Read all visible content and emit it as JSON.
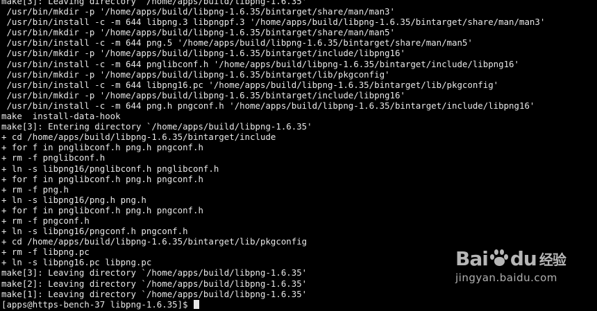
{
  "terminal": {
    "lines": [
      "make[3]: Leaving directory `/home/apps/build/libpng-1.6.35'",
      " /usr/bin/mkdir -p '/home/apps/build/libpng-1.6.35/bintarget/share/man/man3'",
      " /usr/bin/install -c -m 644 libpng.3 libpngpf.3 '/home/apps/build/libpng-1.6.35/bintarget/share/man/man3'",
      " /usr/bin/mkdir -p '/home/apps/build/libpng-1.6.35/bintarget/share/man/man5'",
      " /usr/bin/install -c -m 644 png.5 '/home/apps/build/libpng-1.6.35/bintarget/share/man/man5'",
      " /usr/bin/mkdir -p '/home/apps/build/libpng-1.6.35/bintarget/include/libpng16'",
      " /usr/bin/install -c -m 644 pnglibconf.h '/home/apps/build/libpng-1.6.35/bintarget/include/libpng16'",
      " /usr/bin/mkdir -p '/home/apps/build/libpng-1.6.35/bintarget/lib/pkgconfig'",
      " /usr/bin/install -c -m 644 libpng16.pc '/home/apps/build/libpng-1.6.35/bintarget/lib/pkgconfig'",
      " /usr/bin/mkdir -p '/home/apps/build/libpng-1.6.35/bintarget/include/libpng16'",
      " /usr/bin/install -c -m 644 png.h pngconf.h '/home/apps/build/libpng-1.6.35/bintarget/include/libpng16'",
      "make  install-data-hook",
      "make[3]: Entering directory `/home/apps/build/libpng-1.6.35'",
      "+ cd /home/apps/build/libpng-1.6.35/bintarget/include",
      "+ for f in pnglibconf.h png.h pngconf.h",
      "+ rm -f pnglibconf.h",
      "+ ln -s libpng16/pnglibconf.h pnglibconf.h",
      "+ for f in pnglibconf.h png.h pngconf.h",
      "+ rm -f png.h",
      "+ ln -s libpng16/png.h png.h",
      "+ for f in pnglibconf.h png.h pngconf.h",
      "+ rm -f pngconf.h",
      "+ ln -s libpng16/pngconf.h pngconf.h",
      "+ cd /home/apps/build/libpng-1.6.35/bintarget/lib/pkgconfig",
      "+ rm -f libpng.pc",
      "+ ln -s libpng16.pc libpng.pc",
      "make[3]: Leaving directory `/home/apps/build/libpng-1.6.35'",
      "make[2]: Leaving directory `/home/apps/build/libpng-1.6.35'",
      "make[1]: Leaving directory `/home/apps/build/libpng-1.6.35'"
    ],
    "prompt": "[apps@https-bench-37 libpng-1.6.35]$ "
  },
  "watermark": {
    "logo_part1": "Bai",
    "logo_part2": "du",
    "logo_cn": "经验",
    "site": "jingyan.baidu.com"
  },
  "colors": {
    "background": "#000000",
    "foreground": "#e8e8e8",
    "watermark": "#e9e9e9"
  }
}
